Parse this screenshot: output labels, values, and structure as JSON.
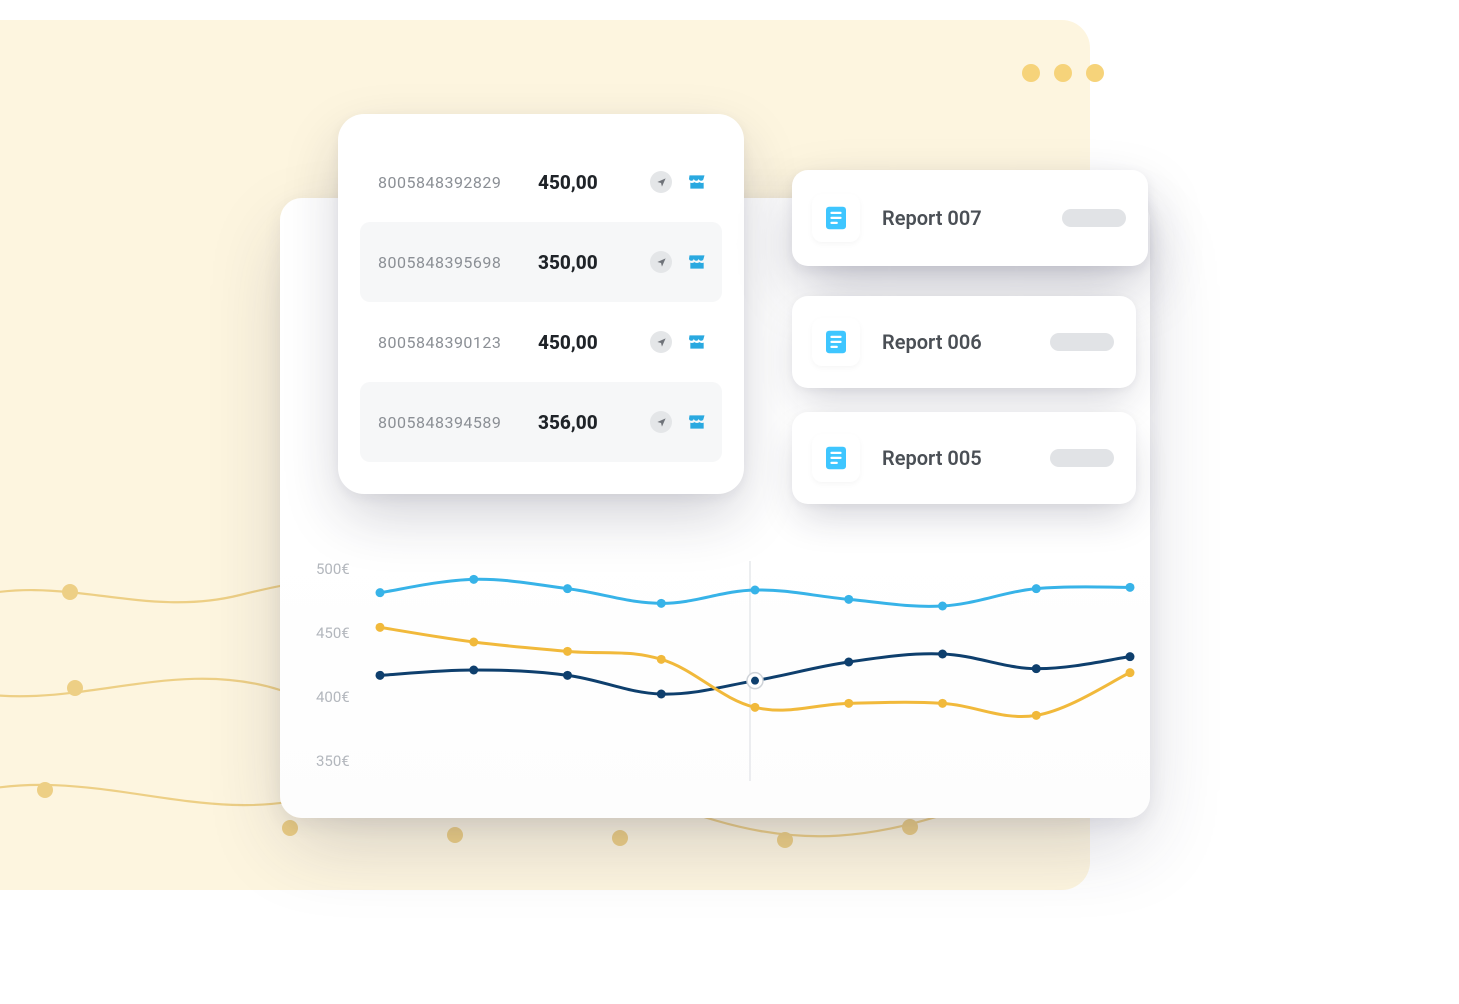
{
  "window": {
    "traffic_dots": 3
  },
  "transactions": {
    "rows": [
      {
        "id": "8005848392829",
        "amount": "450,00",
        "alt": false
      },
      {
        "id": "8005848395698",
        "amount": "350,00",
        "alt": true
      },
      {
        "id": "8005848390123",
        "amount": "450,00",
        "alt": false
      },
      {
        "id": "8005848394589",
        "amount": "356,00",
        "alt": true
      }
    ]
  },
  "reports": [
    {
      "label": "Report 007"
    },
    {
      "label": "Report 006"
    },
    {
      "label": "Report 005"
    }
  ],
  "chart_data": {
    "type": "line",
    "x": [
      1,
      2,
      3,
      4,
      5,
      6,
      7,
      8,
      9
    ],
    "ylabel": "",
    "xlabel": "",
    "ylim": [
      350,
      500
    ],
    "y_ticks": [
      "500€",
      "450€",
      "400€",
      "350€"
    ],
    "currency": "€",
    "series": [
      {
        "name": "series-blue-light",
        "color": "#37b3e8",
        "values": [
          480,
          490,
          483,
          472,
          482,
          475,
          470,
          483,
          484
        ]
      },
      {
        "name": "series-navy",
        "color": "#0e3f6d",
        "values": [
          418,
          422,
          418,
          404,
          414,
          428,
          434,
          423,
          432
        ]
      },
      {
        "name": "series-gold",
        "color": "#f1b93b",
        "values": [
          454,
          443,
          436,
          430,
          394,
          397,
          397,
          388,
          420
        ]
      }
    ]
  },
  "colors": {
    "cream": "#fdf5df",
    "traffic": "#f6d37a",
    "blue_light": "#37b3e8",
    "navy": "#0e3f6d",
    "gold": "#f1b93b",
    "doc_icon": "#3ec6ff"
  }
}
